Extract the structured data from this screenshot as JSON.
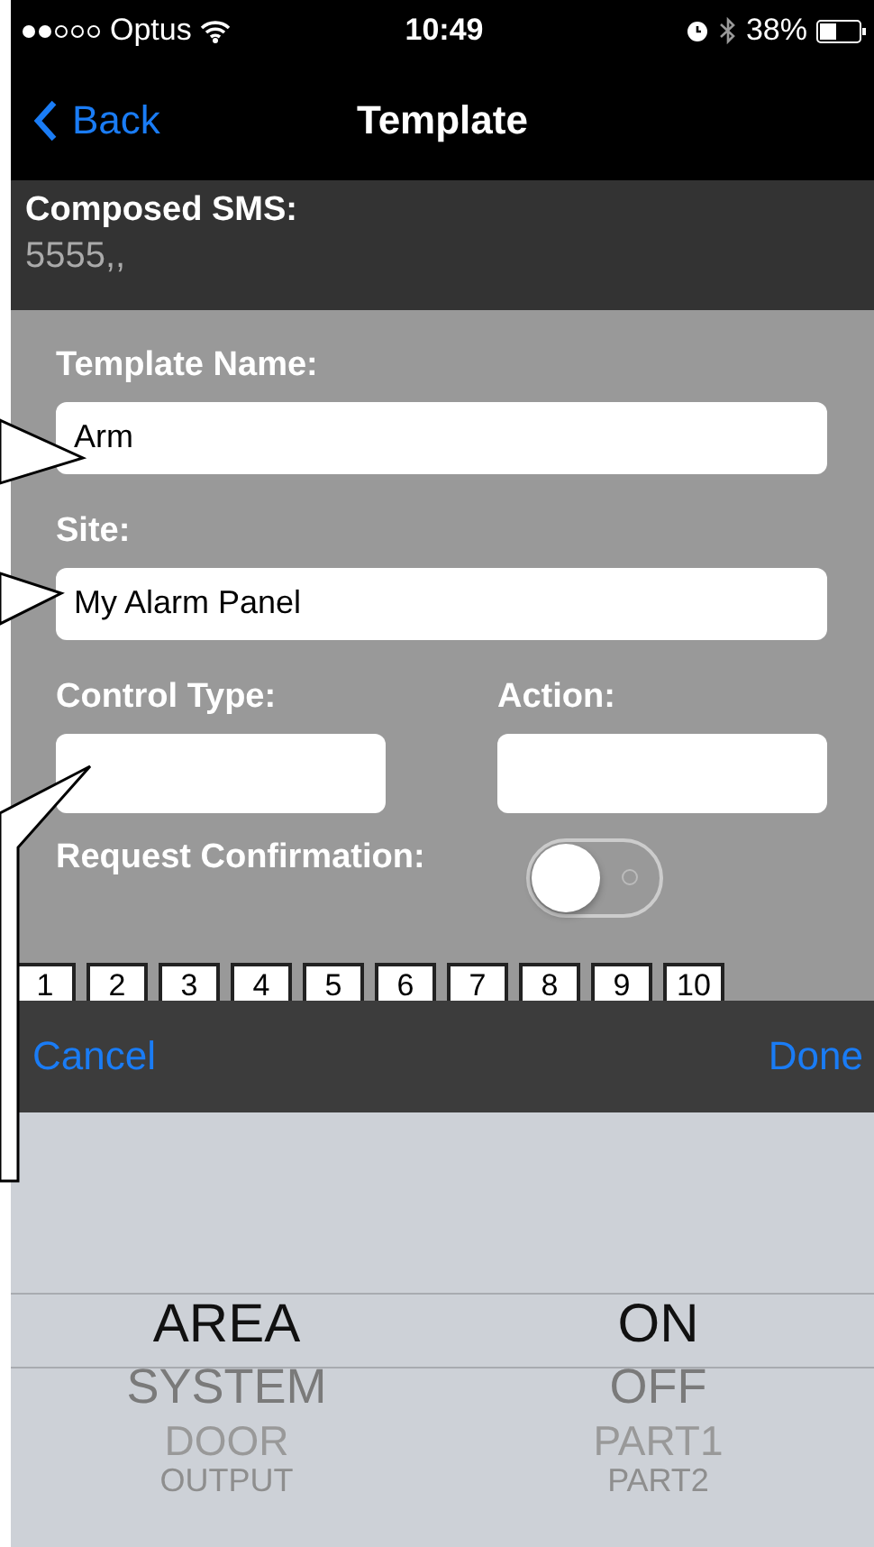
{
  "status_bar": {
    "carrier": "Optus",
    "time": "10:49",
    "battery": "38%"
  },
  "nav": {
    "back": "Back",
    "title": "Template"
  },
  "composed": {
    "label": "Composed SMS:",
    "value": "5555,,"
  },
  "form": {
    "template_name": {
      "label": "Template Name:",
      "value": "Arm"
    },
    "site": {
      "label": "Site:",
      "value": "My Alarm Panel"
    },
    "control_type": {
      "label": "Control Type:"
    },
    "action": {
      "label": "Action:"
    },
    "request_confirmation": {
      "label": "Request Confirmation:",
      "on": false
    }
  },
  "number_tabs": [
    {
      "label": "1"
    },
    {
      "label": "2"
    },
    {
      "label": "3"
    },
    {
      "label": "4"
    },
    {
      "label": "5"
    },
    {
      "label": "6"
    },
    {
      "label": "7"
    },
    {
      "label": "8"
    },
    {
      "label": "9"
    },
    {
      "label": "10"
    }
  ],
  "toolbar": {
    "cancel": "Cancel",
    "done": "Done"
  },
  "picker": {
    "columns": [
      {
        "items": [
          {
            "label": "AREA",
            "selected": true
          },
          {
            "label": "SYSTEM",
            "selected": false
          },
          {
            "label": "DOOR",
            "selected": false
          },
          {
            "label": "OUTPUT",
            "selected": false
          }
        ]
      },
      {
        "items": [
          {
            "label": "ON",
            "selected": true
          },
          {
            "label": "OFF",
            "selected": false
          },
          {
            "label": "PART1",
            "selected": false
          },
          {
            "label": "PART2",
            "selected": false
          }
        ]
      }
    ]
  }
}
